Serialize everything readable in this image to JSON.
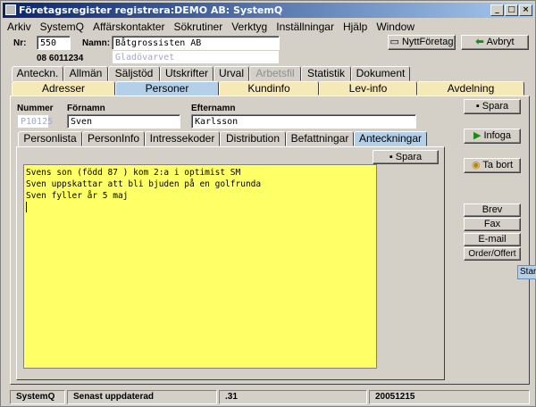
{
  "window": {
    "title": "Företagsregister registrera:DEMO AB: SystemQ",
    "min": "_",
    "max": "□",
    "close": "×"
  },
  "menu": [
    "Arkiv",
    "SystemQ",
    "Affärskontakter",
    "Sökrutiner",
    "Verktyg",
    "Inställningar",
    "Hjälp",
    "Window"
  ],
  "header": {
    "nr_label": "Nr:",
    "nr_value": "550",
    "namn_label": "Namn:",
    "namn_value": "Båtgrossisten AB",
    "phone": "08 6011234",
    "sub_name": "Gladövarvet",
    "new_company_btn": "NyttFöretag",
    "cancel_btn": "Avbryt"
  },
  "tabs_row1": [
    "Anteckn.",
    "Allmän",
    "Säljstöd",
    "Utskrifter",
    "Urval",
    "Arbetsfil",
    "Statistik",
    "Dokument"
  ],
  "tabs_row2": [
    "Adresser",
    "Personer",
    "Kundinfo",
    "Lev-info",
    "Avdelning"
  ],
  "person": {
    "nummer_label": "Nummer",
    "fornamn_label": "Förnamn",
    "efternamn_label": "Efternamn",
    "nummer_value": "P10125",
    "fornamn_value": "Sven",
    "efternamn_value": "Karlsson"
  },
  "tabs_row3": [
    "Personlista",
    "PersonInfo",
    "Intressekoder",
    "Distribution",
    "Befattningar",
    "Anteckningar"
  ],
  "notes_save": "Spara",
  "notes_lines": [
    "Svens son (född 87 ) kom 2:a i optimist SM",
    "Sven uppskattar att bli bjuden på en golfrunda",
    "Sven fyller år 5 maj"
  ],
  "right_buttons": {
    "spara": "Spara",
    "infoga": "Infoga",
    "ta_bort": "Ta bort",
    "brev": "Brev",
    "fax": "Fax",
    "email": "E-mail",
    "order": "Order/Offert",
    "start": "Star"
  },
  "status": {
    "app": "SystemQ",
    "updated": "Senast uppdaterad",
    "code": ".31",
    "date": "20051215"
  }
}
